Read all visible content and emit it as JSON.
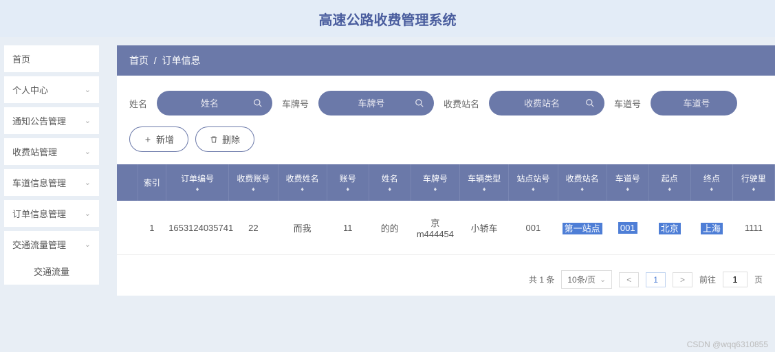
{
  "header": {
    "title": "高速公路收费管理系统"
  },
  "sidebar": {
    "items": [
      {
        "label": "首页",
        "expandable": false
      },
      {
        "label": "个人中心",
        "expandable": true
      },
      {
        "label": "通知公告管理",
        "expandable": true
      },
      {
        "label": "收费站管理",
        "expandable": true
      },
      {
        "label": "车道信息管理",
        "expandable": true
      },
      {
        "label": "订单信息管理",
        "expandable": true
      },
      {
        "label": "交通流量管理",
        "expandable": true
      }
    ],
    "subitem": "交通流量"
  },
  "breadcrumb": {
    "root": "首页",
    "sep": "/",
    "current": "订单信息"
  },
  "filters": [
    {
      "label": "姓名",
      "placeholder": "姓名"
    },
    {
      "label": "车牌号",
      "placeholder": "车牌号"
    },
    {
      "label": "收费站名",
      "placeholder": "收费站名"
    },
    {
      "label": "车道号",
      "placeholder": "车道号"
    }
  ],
  "actions": {
    "add": "新增",
    "delete": "删除"
  },
  "table": {
    "headers": [
      "索引",
      "订单编号",
      "收费账号",
      "收费姓名",
      "账号",
      "姓名",
      "车牌号",
      "车辆类型",
      "站点站号",
      "收费站名",
      "车道号",
      "起点",
      "终点",
      "行驶里"
    ],
    "rows": [
      {
        "cells": [
          "1",
          "1653124035741",
          "22",
          "而我",
          "11",
          "的的",
          "京m444454",
          "小轿车",
          "001",
          "第一站点",
          "001",
          "北京",
          "上海",
          "1111"
        ],
        "highlighted": [
          9,
          10,
          11,
          12
        ]
      }
    ]
  },
  "pager": {
    "total_label": "共 1 条",
    "per_page": "10条/页",
    "current": "1",
    "goto_prefix": "前往",
    "goto_value": "1",
    "goto_suffix": "页"
  },
  "watermark": "CSDN @wqq6310855"
}
